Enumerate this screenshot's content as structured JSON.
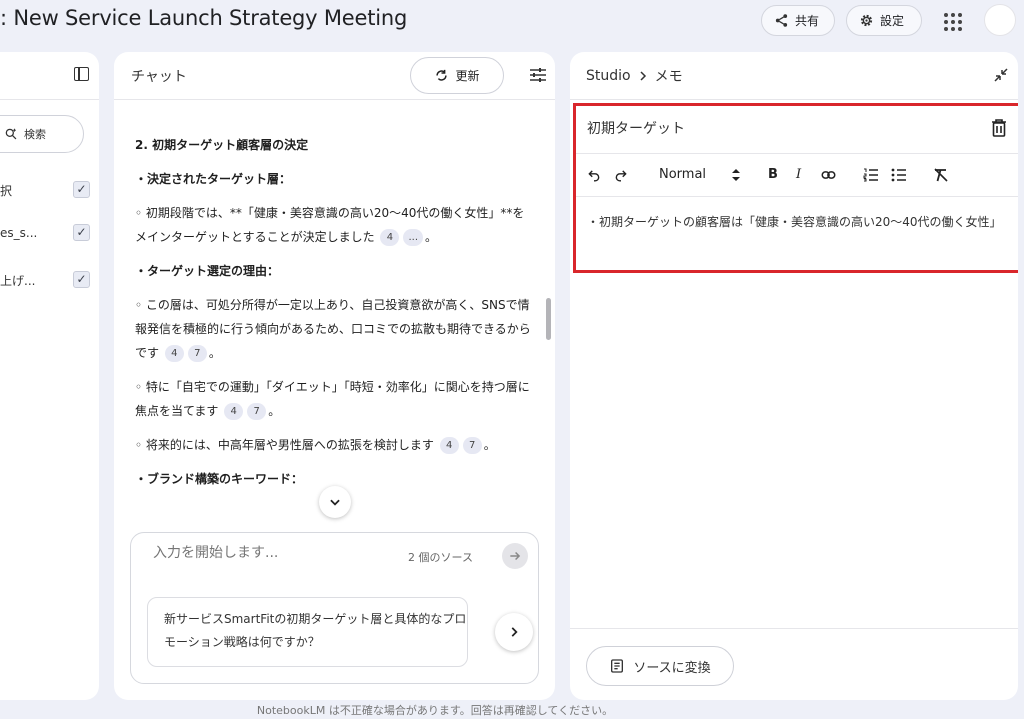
{
  "header": {
    "title": ": New Service Launch Strategy Meeting",
    "share_label": "共有",
    "settings_label": "設定"
  },
  "sources": {
    "search_label": "検索",
    "items": [
      {
        "label": "択",
        "checked": true
      },
      {
        "label": "es_s...",
        "checked": true
      },
      {
        "label": "上げ...",
        "checked": true
      }
    ]
  },
  "chat": {
    "title": "チャット",
    "refresh_label": "更新",
    "section_heading": "2. 初期ターゲット顧客層の決定",
    "decided_heading": "・決定されたターゲット層：",
    "decided_text": "◦ 初期段階では、**「健康・美容意識の高い20〜40代の働く女性」**をメインターゲットとすることが決定しました",
    "decided_cites": [
      "4",
      "..."
    ],
    "reason_heading": "・ターゲット選定の理由：",
    "reason1_text": "◦ この層は、可処分所得が一定以上あり、自己投資意欲が高く、SNSで情報発信を積極的に行う傾向があるため、口コミでの拡散も期待できるからです",
    "reason1_cites": [
      "4",
      "7"
    ],
    "reason2_text": "◦ 特に「自宅での運動」「ダイエット」「時短・効率化」に関心を持つ層に焦点を当てます",
    "reason2_cites": [
      "4",
      "7"
    ],
    "reason3_text": "◦ 将来的には、中高年層や男性層への拡張を検討します",
    "reason3_cites": [
      "4",
      "7"
    ],
    "cut_heading": "・ブランド構築のキーワード：",
    "input_placeholder": "入力を開始します...",
    "source_count": "2 個のソース",
    "suggestion": "新サービスSmartFitの初期ターゲット層と具体的なプロモーション戦略は何ですか？"
  },
  "studio": {
    "crumb_root": "Studio",
    "crumb_current": "メモ",
    "note_title": "初期ターゲット",
    "format_label": "Normal",
    "note_body": "・初期ターゲットの顧客層は「健康・美容意識の高い20〜40代の働く女性」",
    "convert_label": "ソースに変換"
  },
  "footer": {
    "disclaimer": "NotebookLM は不正確な場合があります。回答は再確認してください。"
  },
  "colors": {
    "background": "#eef0f8",
    "highlight_border": "#d9262b",
    "citation_chip": "#e6e8f3"
  }
}
